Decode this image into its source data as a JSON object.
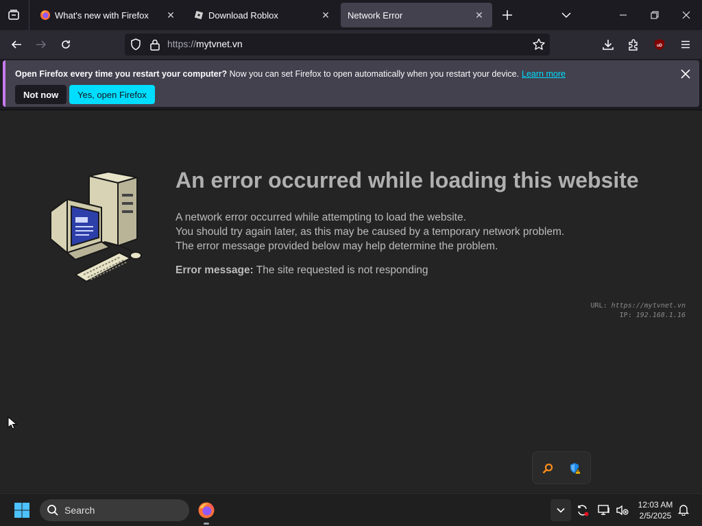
{
  "tabs": [
    {
      "title": "What's new with Firefox",
      "icon": "firefox-icon",
      "active": false
    },
    {
      "title": "Download Roblox",
      "icon": "roblox-icon",
      "active": false
    },
    {
      "title": "Network Error",
      "icon": "",
      "active": true
    }
  ],
  "navbar": {
    "url_prefix": "https://",
    "url_host": "mytvnet.vn",
    "icons": [
      "back-arrow-icon",
      "forward-arrow-icon",
      "reload-icon",
      "shield-icon",
      "lock-icon",
      "star-icon",
      "download-icon",
      "extensions-icon",
      "ublock-icon",
      "menu-icon"
    ]
  },
  "notification": {
    "bold_text": "Open Firefox every time you restart your computer?",
    "text": " Now you can set Firefox to open automatically when you restart your device.",
    "link": "Learn more",
    "not_now_label": "Not now",
    "yes_label": "Yes, open Firefox"
  },
  "error_page": {
    "title": "An error occurred while loading this website",
    "lines": [
      "A network error occurred while attempting to load the website.",
      "You should try again later, as this may be caused by a temporary network problem.",
      "The error message provided below may help determine the problem."
    ],
    "error_label": "Error message:",
    "error_value": " The site requested is not responding",
    "url_label": "URL: ",
    "url_value": "https://mytvnet.vn",
    "ip_label": "IP: ",
    "ip_value": "192.168.1.16"
  },
  "taskbar": {
    "search_label": "Search",
    "time": "12:03 AM",
    "date": "2/5/2025"
  },
  "colors": {
    "accent": "#00ddff",
    "notification_bg": "#42414d",
    "page_bg": "#242424"
  }
}
